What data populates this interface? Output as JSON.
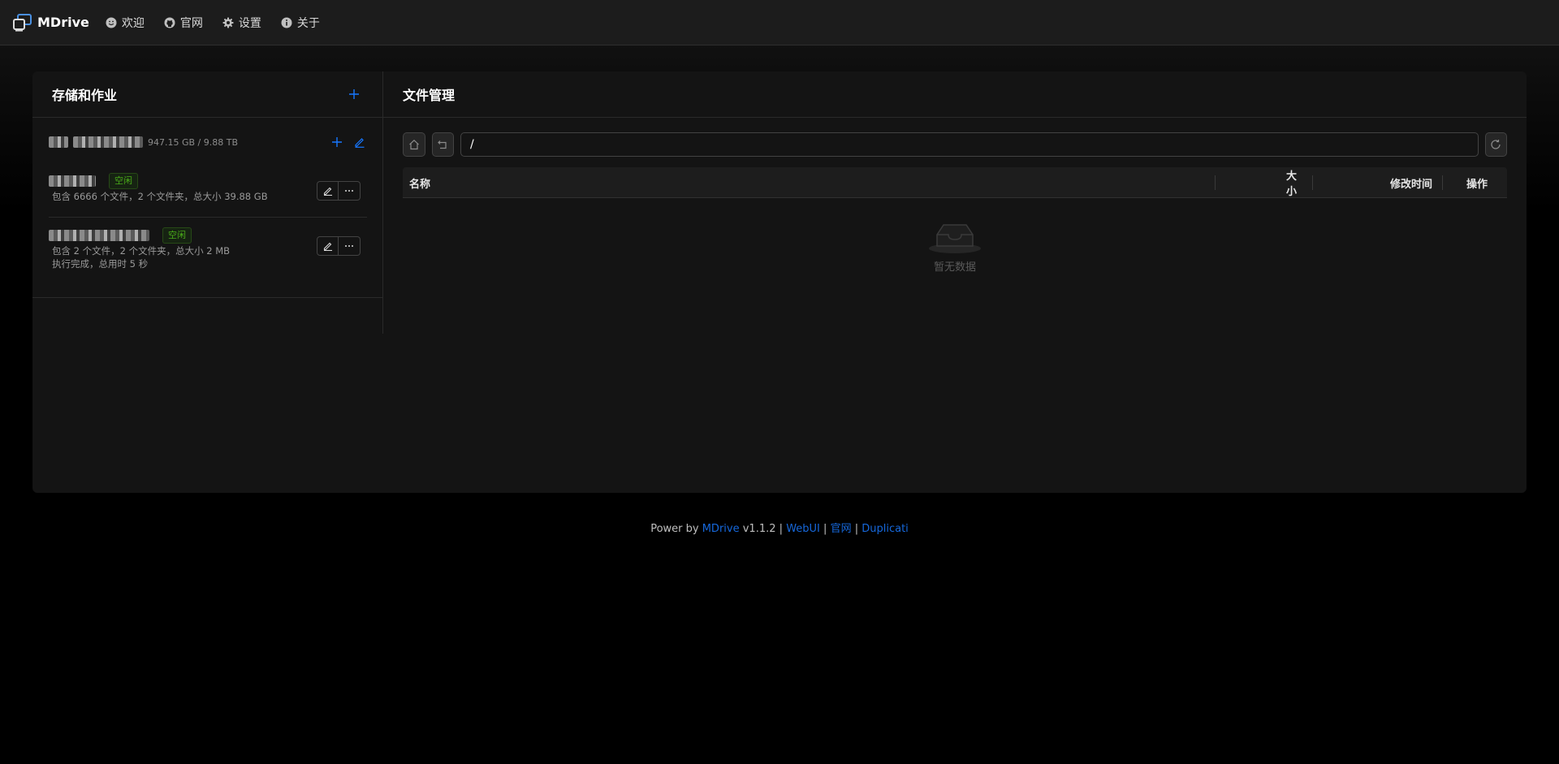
{
  "header": {
    "brand": "MDrive",
    "nav": [
      {
        "label": "欢迎",
        "icon": "smile-icon"
      },
      {
        "label": "官网",
        "icon": "github-icon"
      },
      {
        "label": "设置",
        "icon": "gear-icon"
      },
      {
        "label": "关于",
        "icon": "info-icon"
      }
    ]
  },
  "left_panel": {
    "title": "存储和作业",
    "storage": {
      "size": "947.15 GB / 9.88 TB"
    },
    "jobs": [
      {
        "status": "空闲",
        "desc": "包含 6666 个文件，2 个文件夹，总大小 39.88 GB"
      },
      {
        "status": "空闲",
        "desc": "包含 2 个文件，2 个文件夹，总大小 2 MB",
        "desc2": "执行完成，总用时 5 秒"
      }
    ]
  },
  "file_manager": {
    "title": "文件管理",
    "path": "/",
    "columns": {
      "name": "名称",
      "size": "大小",
      "mtime": "修改时间",
      "action": "操作"
    },
    "empty_text": "暂无数据"
  },
  "footer": {
    "prefix": "Power by",
    "mdrive": "MDrive",
    "version": "v1.1.2",
    "sep": "|",
    "webui": "WebUI",
    "site": "官网",
    "duplicati": "Duplicati"
  },
  "colors": {
    "accent": "#1677ff",
    "success": "#49aa19",
    "background": "#000000",
    "panel": "#141414"
  }
}
